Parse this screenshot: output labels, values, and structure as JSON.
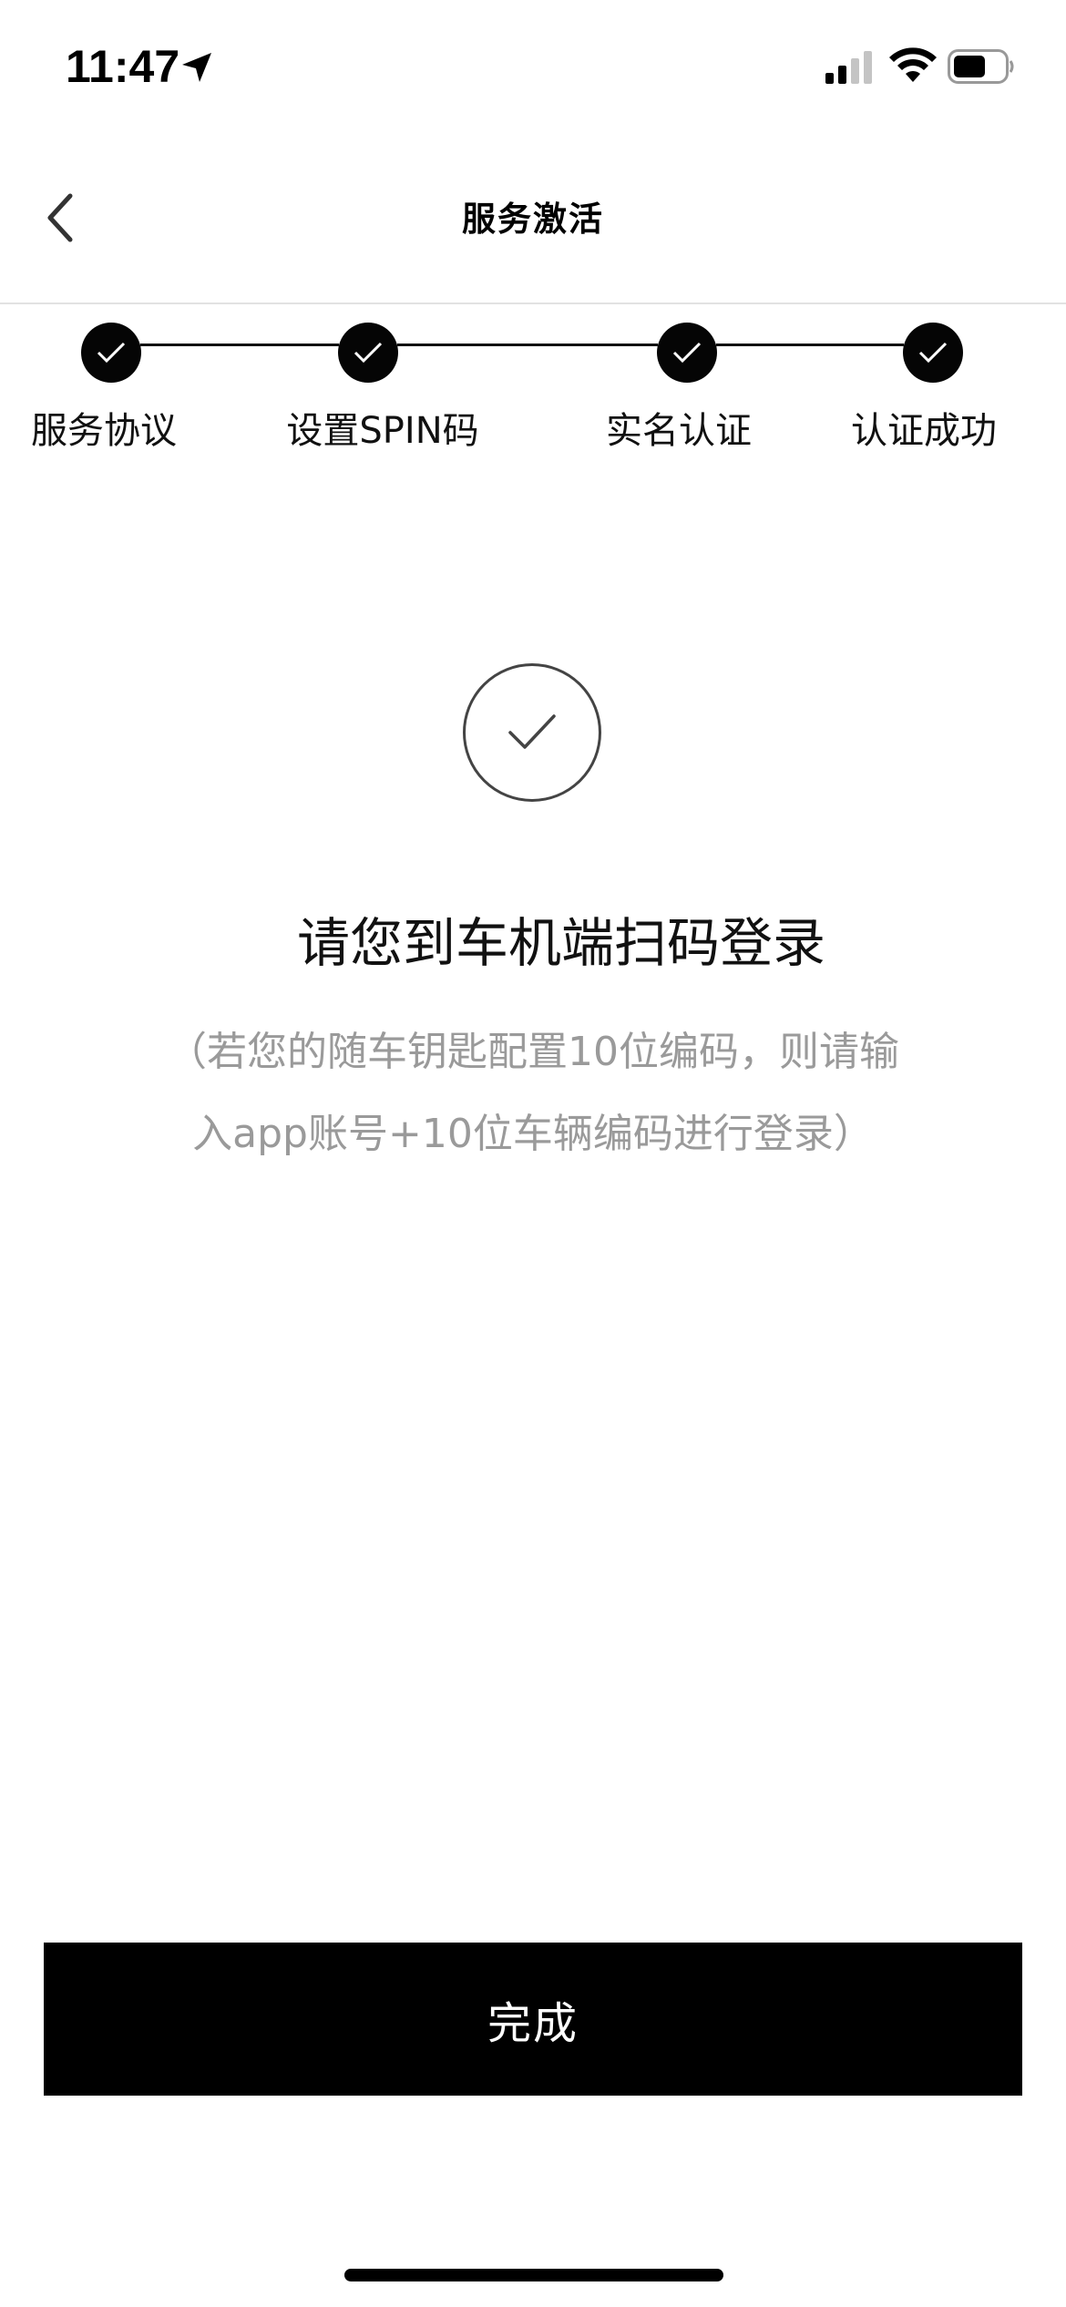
{
  "status_bar": {
    "time": "11:47",
    "icons": [
      "location-arrow-icon",
      "cellular-signal-icon",
      "wifi-icon",
      "battery-icon"
    ]
  },
  "nav": {
    "back_icon": "chevron-left-icon",
    "title": "服务激活"
  },
  "stepper": {
    "steps": [
      {
        "label": "服务协议",
        "completed": true
      },
      {
        "label": "设置SPIN码",
        "completed": true
      },
      {
        "label": "实名认证",
        "completed": true
      },
      {
        "label": "认证成功",
        "completed": true
      }
    ],
    "check_icon": "checkmark-icon"
  },
  "result": {
    "icon": "success-check-icon",
    "message": "请您到车机端扫码登录",
    "hint_line1": "（若您的随车钥匙配置10位编码，则请输",
    "hint_line2": "入app账号+10位车辆编码进行登录）"
  },
  "actions": {
    "done_label": "完成"
  },
  "colors": {
    "primary": "#000000",
    "hint_text": "#9a9a9a",
    "divider": "#e2e2e2",
    "background": "#ffffff"
  }
}
